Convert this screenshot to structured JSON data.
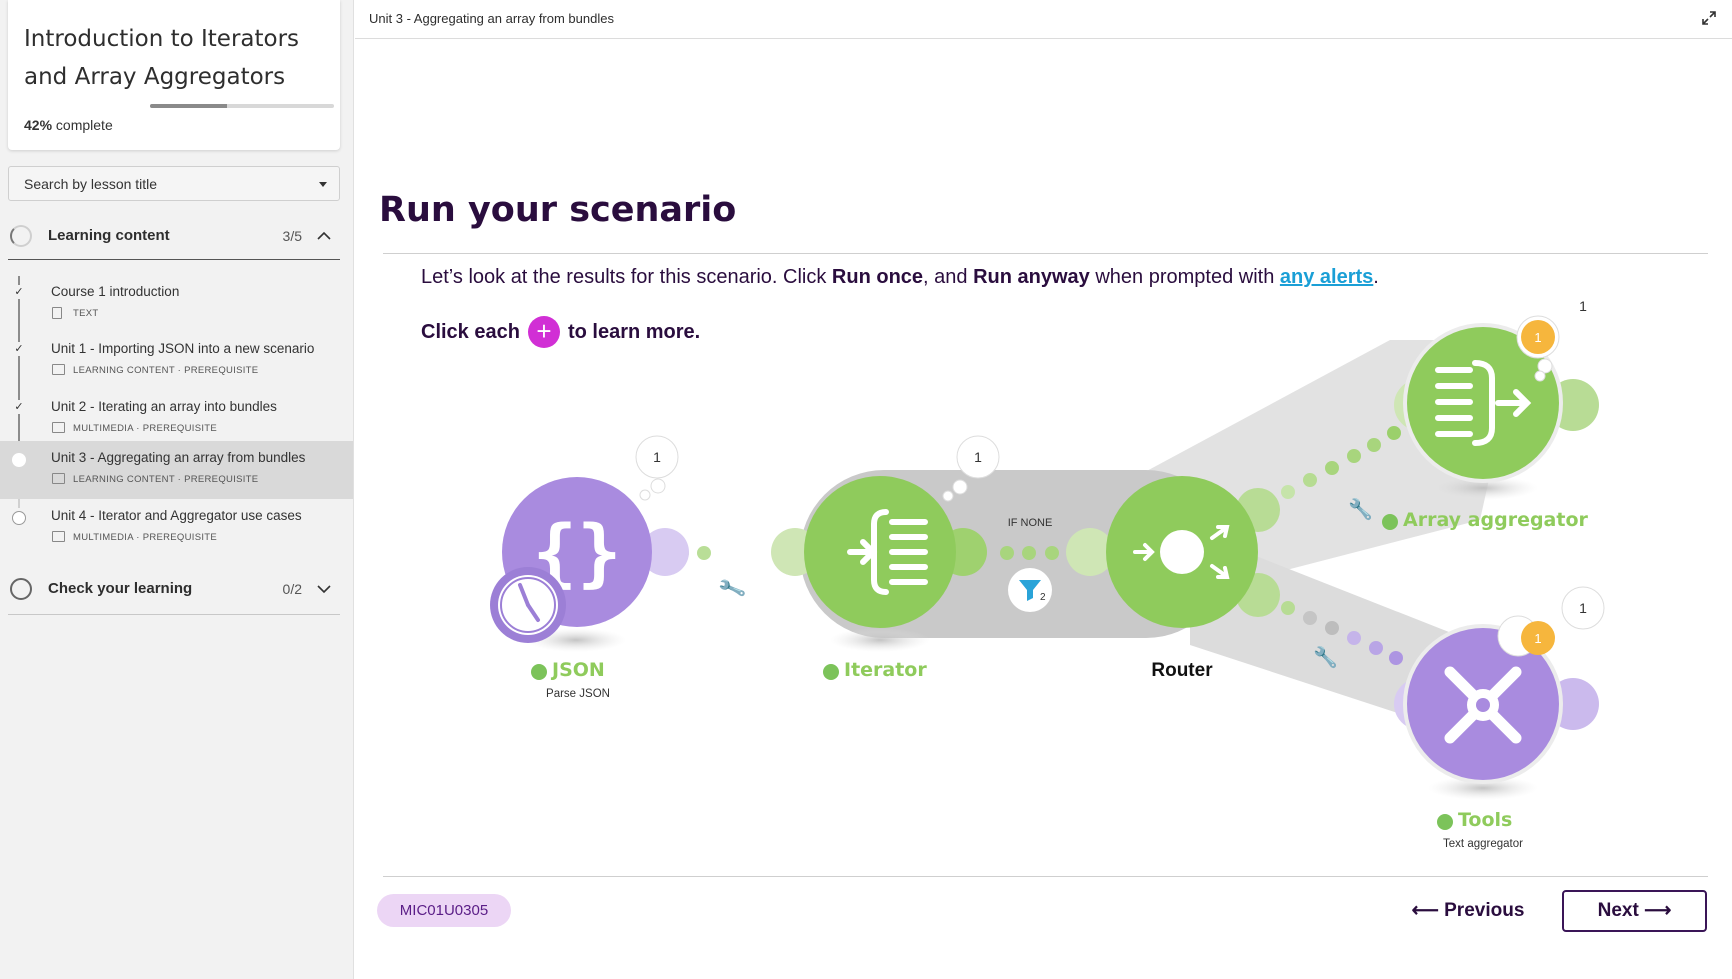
{
  "sidebar": {
    "course_title": "Introduction to Iterators and Array Aggregators",
    "progress_percent": 42,
    "progress_value": "42%",
    "progress_suffix": "complete",
    "search_placeholder": "Search by lesson title",
    "sections": [
      {
        "label": "Learning content",
        "count": "3/5",
        "expanded": true,
        "lessons": [
          {
            "title": "Course 1 introduction",
            "meta": "TEXT",
            "completed": true,
            "active": false
          },
          {
            "title": "Unit 1 - Importing JSON into a new scenario",
            "meta": "LEARNING CONTENT · PREREQUISITE",
            "completed": true,
            "active": false
          },
          {
            "title": "Unit 2 - Iterating an array into bundles",
            "meta": "MULTIMEDIA · PREREQUISITE",
            "completed": true,
            "active": false
          },
          {
            "title": "Unit 3 - Aggregating an array from bundles",
            "meta": "LEARNING CONTENT · PREREQUISITE",
            "completed": false,
            "active": true
          },
          {
            "title": "Unit 4 - Iterator and Aggregator use cases",
            "meta": "MULTIMEDIA · PREREQUISITE",
            "completed": false,
            "active": false
          }
        ]
      },
      {
        "label": "Check your learning",
        "count": "0/2",
        "expanded": false
      }
    ]
  },
  "topbar": {
    "unit_title": "Unit 3 - Aggregating an array from bundles"
  },
  "content": {
    "heading": "Run your scenario",
    "intro_part1": "Let’s look at the results for this scenario. Click ",
    "intro_bold1": "Run once",
    "intro_part2": ", and ",
    "intro_bold2": "Run anyway",
    "intro_part3": " when prompted with ",
    "intro_link": "any alerts",
    "intro_part4": ".",
    "click_before": "Click each",
    "click_plus": "+",
    "click_after": "to learn more."
  },
  "diagram": {
    "colors": {
      "purple": "#a98bdf",
      "green": "#8fcb5c",
      "grey": "#c8c8c8",
      "orange": "#f6b63d"
    },
    "modules": {
      "json": {
        "label": "JSON",
        "sub": "Parse JSON",
        "bubble": "1"
      },
      "iterator": {
        "label": "Iterator",
        "bubble": "1"
      },
      "router": {
        "label": "Router",
        "filter_label": "IF NONE",
        "filter_count": "2"
      },
      "array_aggregator": {
        "label": "Array aggregator",
        "bubble": "1",
        "badge": "1"
      },
      "tools": {
        "label": "Tools",
        "sub": "Text aggregator",
        "bubble": "1",
        "badge": "1"
      }
    }
  },
  "footer": {
    "code": "MIC01U0305",
    "prev_label": "Previous",
    "next_label": "Next"
  }
}
